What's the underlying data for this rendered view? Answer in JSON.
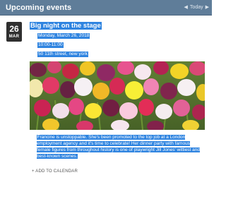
{
  "header": {
    "title": "Upcoming events",
    "prev_icon": "chevron-left-icon",
    "next_icon": "chevron-right-icon",
    "today_label": "Today"
  },
  "event": {
    "day": "26",
    "month": "MAR",
    "title": "Big night on the stage",
    "date": "Monday, March 26, 2018",
    "time": "10:00-11:00",
    "location": "50 11th street, new york",
    "image_subject": "tulips-photo",
    "description": "Francine is unstoppable. She's been promoted to the top job at a London employment agency and it's time to celebrate! Her dinner party with famous female figures from throughout history is one of playwright Jill Jones' wittiest and best-known scenes.",
    "add_to_calendar": "+ ADD TO CALENDAR"
  },
  "colors": {
    "header_bg": "#5f7d99",
    "selection": "#2f84e0",
    "date_box": "#2f2f2f"
  }
}
